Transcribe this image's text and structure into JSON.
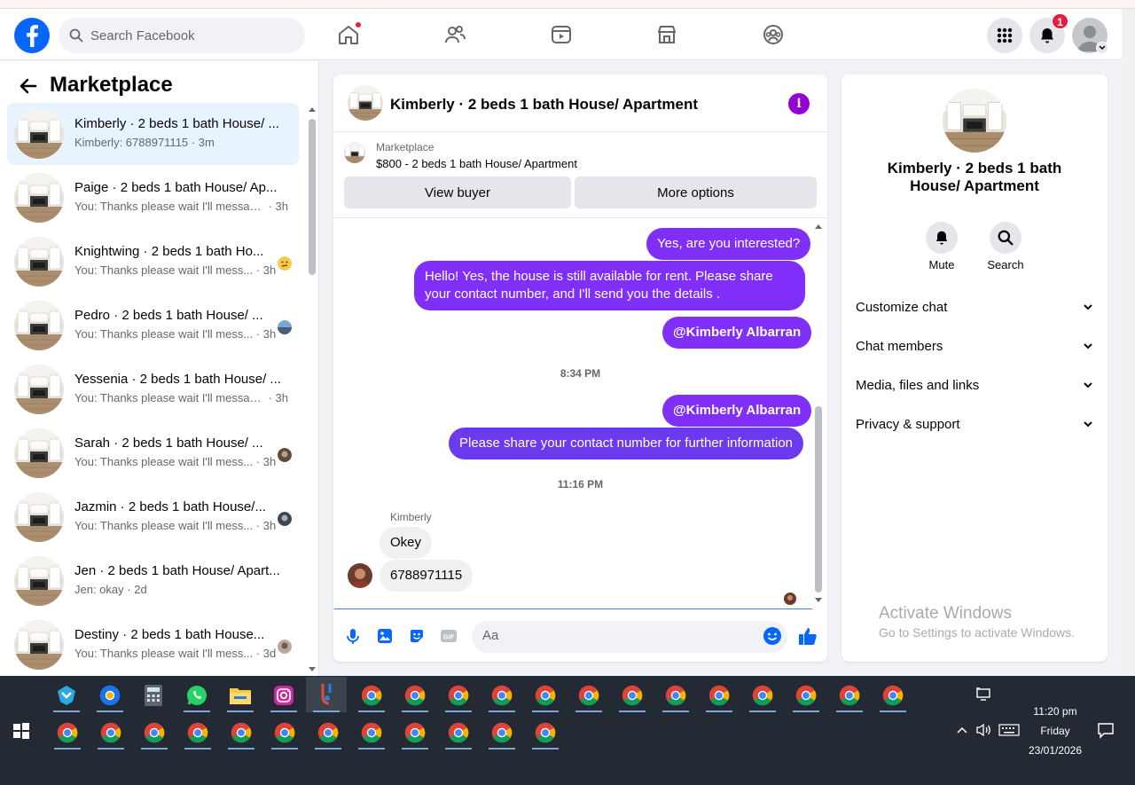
{
  "top_nav": {
    "search_placeholder": "Search Facebook",
    "notification_count": "1"
  },
  "sidebar": {
    "title": "Marketplace",
    "conversations": [
      {
        "title": "Kimberly · 2 beds 1 bath House/ ...",
        "message": "Kimberly: 6788971115",
        "time": " · 3m",
        "active": true
      },
      {
        "title": "Paige · 2 beds 1 bath House/ Ap...",
        "message": "You: Thanks please wait I'll messag...",
        "time": " · 3h"
      },
      {
        "title": "Knightwing · 2 beds 1 bath Ho...",
        "message": "You: Thanks please wait I'll mess...",
        "time": " · 3h"
      },
      {
        "title": "Pedro · 2 beds 1 bath House/ ...",
        "message": "You: Thanks please wait I'll mess...",
        "time": " · 3h"
      },
      {
        "title": "Yessenia · 2 beds 1 bath House/ ...",
        "message": "You: Thanks please wait I'll messag...",
        "time": " · 3h"
      },
      {
        "title": "Sarah · 2 beds 1 bath House/ ...",
        "message": "You: Thanks please wait I'll mess...",
        "time": " · 3h"
      },
      {
        "title": "Jazmin · 2 beds 1 bath House/...",
        "message": "You: Thanks please wait I'll mess...",
        "time": " · 3h"
      },
      {
        "title": "Jen · 2 beds 1 bath House/ Apart...",
        "message": "Jen: okay",
        "time": " · 2d"
      },
      {
        "title": "Destiny · 2 beds 1 bath House...",
        "message": "You: Thanks please wait I'll mess...",
        "time": " · 3d"
      }
    ]
  },
  "chat": {
    "header_title": "Kimberly · 2 beds 1 bath House/ Apartment",
    "marketplace_label": "Marketplace",
    "listing": "$800 - 2 beds 1 bath House/ Apartment",
    "view_buyer": "View buyer",
    "more_options": "More options",
    "messages": {
      "m1": "Yes, are you interested?",
      "m2": "Hello! Yes, the house is still available for rent. Please share your contact number, and I'll send you the details .",
      "m3": "@Kimberly Albarran",
      "t1": "8:34 PM",
      "m4": "@Kimberly Albarran",
      "m5": "Please share your contact number for further information",
      "t2": "11:16 PM",
      "sender": "Kimberly",
      "m6": "Okey",
      "m7": "6788971115"
    },
    "input_placeholder": "Aa"
  },
  "details": {
    "title": "Kimberly · 2 beds 1 bath House/ Apartment",
    "mute": "Mute",
    "search": "Search",
    "rows": [
      "Customize chat",
      "Chat members",
      "Media, files and links",
      "Privacy & support"
    ]
  },
  "watermark": {
    "title": "Activate Windows",
    "subtitle": "Go to Settings to activate Windows."
  },
  "taskbar": {
    "time": "11:20 pm",
    "day": "Friday",
    "date": "23/01/2026"
  },
  "colors": {
    "brand": "#0866ff",
    "outgoing_bubble": "#7f2ff8",
    "info_icon": "#9400d3",
    "notification": "#e41e3f"
  }
}
